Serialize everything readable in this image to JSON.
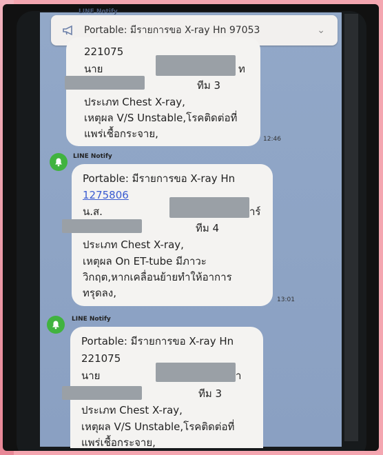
{
  "banner": {
    "text": "Portable: มีรายการขอ X-ray  Hn   97053",
    "sender_top": "LINE Notify"
  },
  "messages": [
    {
      "sender": "",
      "lines": [
        "221075",
        "นาย",
        "ท",
        "ทีม 3",
        "ประเภท  Chest X-ray,",
        "เหตุผล  V/S Unstable,โรคติดต่อที่",
        "แพร่เชื้อกระจาย,"
      ],
      "time": "12:46"
    },
    {
      "sender": "LINE Notify",
      "lines": [
        "Portable: มีรายการขอ X-ray  Hn",
        "1275806",
        "น.ส.",
        "าร์",
        "ทีม 4",
        "ประเภท  Chest X-ray,",
        "เหตุผล  On ET-tube มีภาวะ",
        "วิกฤต,หากเคลื่อนย้ายทำให้อาการ",
        "ทรุดลง,"
      ],
      "time": "13:01"
    },
    {
      "sender": "LINE Notify",
      "lines": [
        "Portable: มีรายการขอ X-ray  Hn",
        "221075",
        "นาย",
        "า",
        "ทีม 3",
        "ประเภท  Chest X-ray,",
        "เหตุผล  V/S Unstable,โรคติดต่อที่",
        "แพร่เชื้อกระจาย,"
      ],
      "time": ""
    }
  ]
}
